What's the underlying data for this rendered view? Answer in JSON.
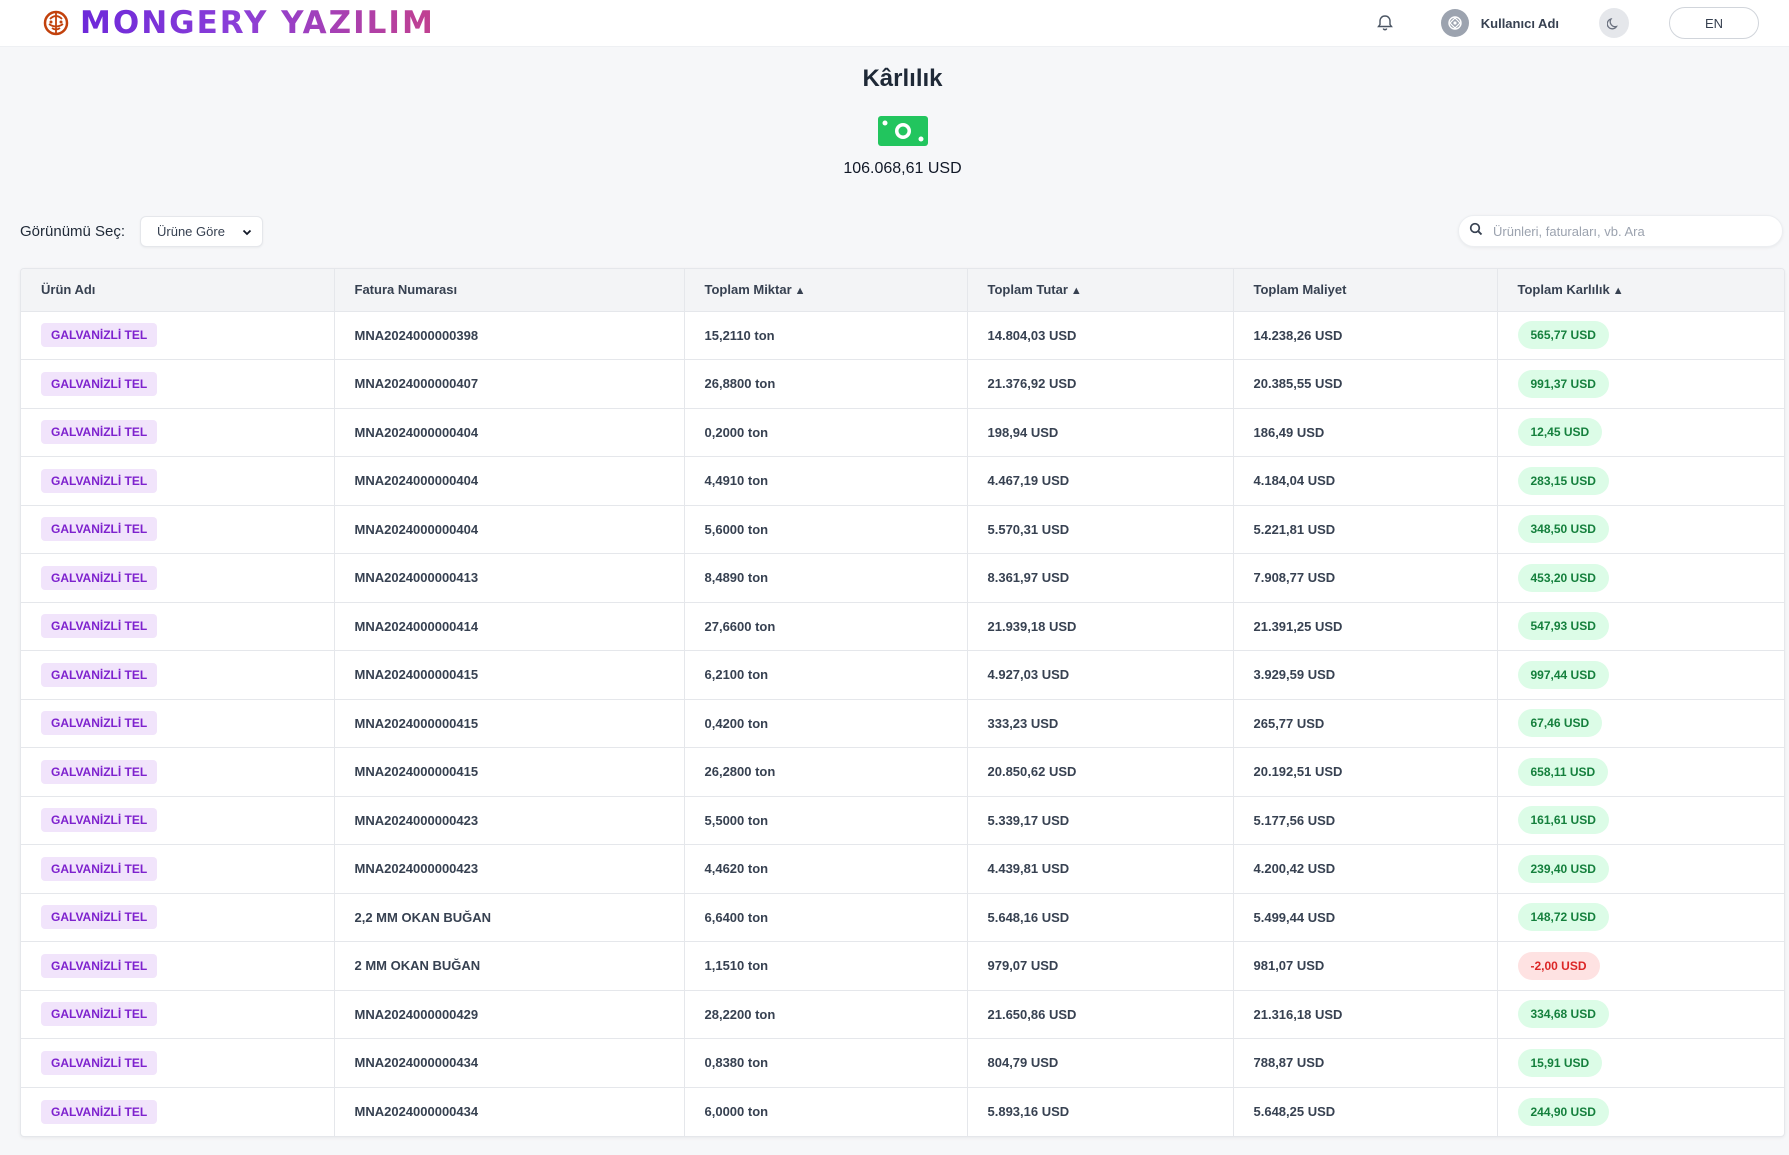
{
  "brand": {
    "name": "MONGERY YAZILIM"
  },
  "user": {
    "name": "Kullanıcı Adı"
  },
  "language": {
    "label": "EN"
  },
  "summary": {
    "title": "Kârlılık",
    "total": "106.068,61 USD",
    "icon": "money-bill-icon"
  },
  "view_select": {
    "label": "Görünümü Seç:",
    "value": "Ürüne Göre"
  },
  "search": {
    "placeholder": "Ürünleri, faturaları, vb. Ara"
  },
  "colors": {
    "positive": "#15803d",
    "negative": "#dc2626",
    "badge": "#7e22ce"
  },
  "table": {
    "columns": [
      {
        "label": "Ürün Adı",
        "sort": ""
      },
      {
        "label": "Fatura Numarası",
        "sort": ""
      },
      {
        "label": "Toplam Miktar",
        "sort": "▲"
      },
      {
        "label": "Toplam Tutar",
        "sort": "▲"
      },
      {
        "label": "Toplam Maliyet",
        "sort": ""
      },
      {
        "label": "Toplam Karlılık",
        "sort": "▲"
      }
    ],
    "rows": [
      {
        "product": "GALVANİZLİ TEL",
        "invoice": "MNA2024000000398",
        "quantity": "15,2110 ton",
        "amount": "14.804,03 USD",
        "cost": "14.238,26 USD",
        "profit": "565,77 USD",
        "negative": false
      },
      {
        "product": "GALVANİZLİ TEL",
        "invoice": "MNA2024000000407",
        "quantity": "26,8800 ton",
        "amount": "21.376,92 USD",
        "cost": "20.385,55 USD",
        "profit": "991,37 USD",
        "negative": false
      },
      {
        "product": "GALVANİZLİ TEL",
        "invoice": "MNA2024000000404",
        "quantity": "0,2000 ton",
        "amount": "198,94 USD",
        "cost": "186,49 USD",
        "profit": "12,45 USD",
        "negative": false
      },
      {
        "product": "GALVANİZLİ TEL",
        "invoice": "MNA2024000000404",
        "quantity": "4,4910 ton",
        "amount": "4.467,19 USD",
        "cost": "4.184,04 USD",
        "profit": "283,15 USD",
        "negative": false
      },
      {
        "product": "GALVANİZLİ TEL",
        "invoice": "MNA2024000000404",
        "quantity": "5,6000 ton",
        "amount": "5.570,31 USD",
        "cost": "5.221,81 USD",
        "profit": "348,50 USD",
        "negative": false
      },
      {
        "product": "GALVANİZLİ TEL",
        "invoice": "MNA2024000000413",
        "quantity": "8,4890 ton",
        "amount": "8.361,97 USD",
        "cost": "7.908,77 USD",
        "profit": "453,20 USD",
        "negative": false
      },
      {
        "product": "GALVANİZLİ TEL",
        "invoice": "MNA2024000000414",
        "quantity": "27,6600 ton",
        "amount": "21.939,18 USD",
        "cost": "21.391,25 USD",
        "profit": "547,93 USD",
        "negative": false
      },
      {
        "product": "GALVANİZLİ TEL",
        "invoice": "MNA2024000000415",
        "quantity": "6,2100 ton",
        "amount": "4.927,03 USD",
        "cost": "3.929,59 USD",
        "profit": "997,44 USD",
        "negative": false
      },
      {
        "product": "GALVANİZLİ TEL",
        "invoice": "MNA2024000000415",
        "quantity": "0,4200 ton",
        "amount": "333,23 USD",
        "cost": "265,77 USD",
        "profit": "67,46 USD",
        "negative": false
      },
      {
        "product": "GALVANİZLİ TEL",
        "invoice": "MNA2024000000415",
        "quantity": "26,2800 ton",
        "amount": "20.850,62 USD",
        "cost": "20.192,51 USD",
        "profit": "658,11 USD",
        "negative": false
      },
      {
        "product": "GALVANİZLİ TEL",
        "invoice": "MNA2024000000423",
        "quantity": "5,5000 ton",
        "amount": "5.339,17 USD",
        "cost": "5.177,56 USD",
        "profit": "161,61 USD",
        "negative": false
      },
      {
        "product": "GALVANİZLİ TEL",
        "invoice": "MNA2024000000423",
        "quantity": "4,4620 ton",
        "amount": "4.439,81 USD",
        "cost": "4.200,42 USD",
        "profit": "239,40 USD",
        "negative": false
      },
      {
        "product": "GALVANİZLİ TEL",
        "invoice": "2,2 MM OKAN BUĞAN",
        "quantity": "6,6400 ton",
        "amount": "5.648,16 USD",
        "cost": "5.499,44 USD",
        "profit": "148,72 USD",
        "negative": false
      },
      {
        "product": "GALVANİZLİ TEL",
        "invoice": "2 MM OKAN BUĞAN",
        "quantity": "1,1510 ton",
        "amount": "979,07 USD",
        "cost": "981,07 USD",
        "profit": "-2,00 USD",
        "negative": true
      },
      {
        "product": "GALVANİZLİ TEL",
        "invoice": "MNA2024000000429",
        "quantity": "28,2200 ton",
        "amount": "21.650,86 USD",
        "cost": "21.316,18 USD",
        "profit": "334,68 USD",
        "negative": false
      },
      {
        "product": "GALVANİZLİ TEL",
        "invoice": "MNA2024000000434",
        "quantity": "0,8380 ton",
        "amount": "804,79 USD",
        "cost": "788,87 USD",
        "profit": "15,91 USD",
        "negative": false
      },
      {
        "product": "GALVANİZLİ TEL",
        "invoice": "MNA2024000000434",
        "quantity": "6,0000 ton",
        "amount": "5.893,16 USD",
        "cost": "5.648,25 USD",
        "profit": "244,90 USD",
        "negative": false
      }
    ]
  }
}
